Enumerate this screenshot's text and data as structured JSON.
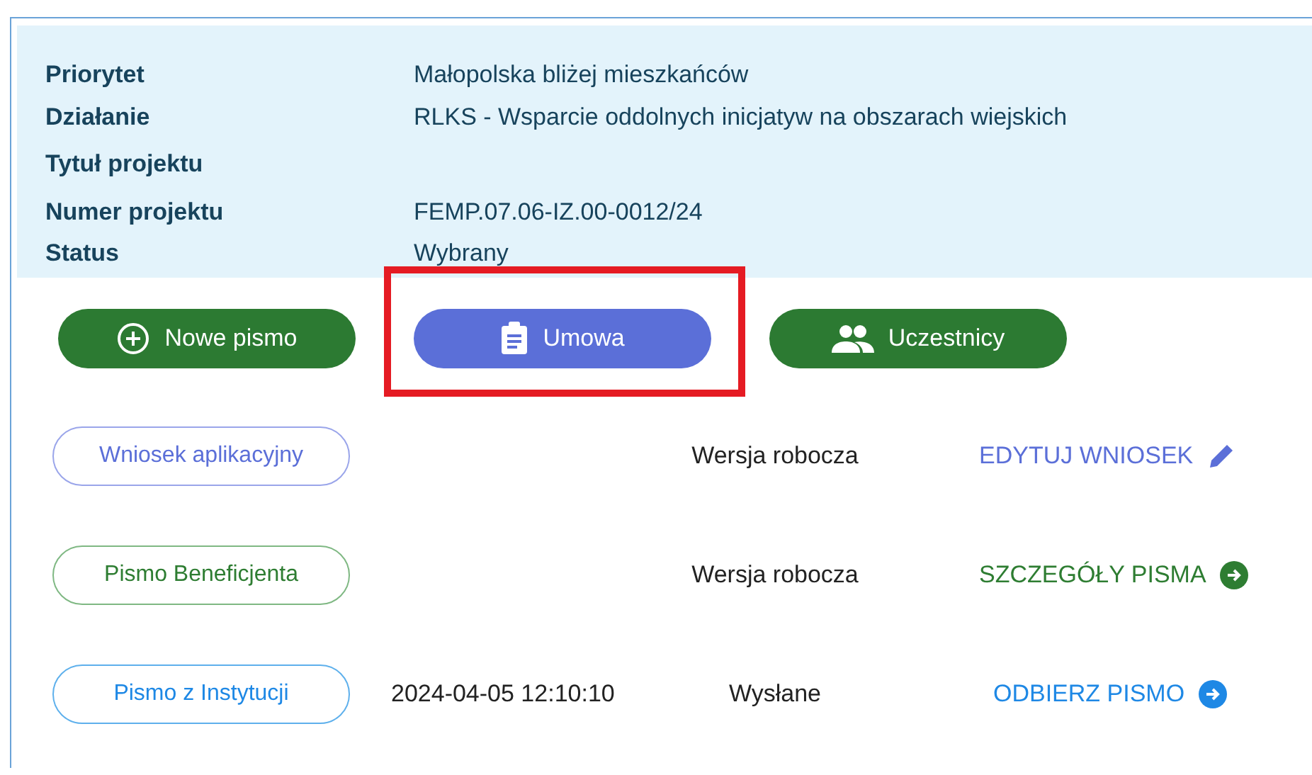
{
  "project_info": [
    {
      "label": "Priorytet",
      "value": "Małopolska bliżej mieszkańców"
    },
    {
      "label": "Działanie",
      "value": "RLKS - Wsparcie oddolnych inicjatyw na obszarach wiejskich"
    },
    {
      "label": "Tytuł projektu"
    },
    {
      "label": "Numer projektu",
      "value": "FEMP.07.06-IZ.00-0012/24"
    },
    {
      "label": "Status",
      "value": "Wybrany"
    }
  ],
  "buttons": [
    {
      "label": "Nowe pismo",
      "kind": "new",
      "highlighted": false
    },
    {
      "label": "Umowa",
      "kind": "contract",
      "highlighted": true
    },
    {
      "label": "Uczestnicy",
      "kind": "participants",
      "highlighted": false
    }
  ],
  "documents": [
    {
      "name": "Wniosek aplikacyjny",
      "kind": "application",
      "status": "Wersja robocza",
      "action": "EDYTUJ WNIOSEK"
    },
    {
      "name": "Pismo Beneficjenta",
      "kind": "beneficiary",
      "status": "Wersja robocza",
      "action": "SZCZEGÓŁY PISMA"
    },
    {
      "name": "Pismo z Instytucji",
      "kind": "institution",
      "date": "2024-04-05 12:10:10",
      "status": "Wysłane",
      "action": "ODBIERZ PISMO"
    }
  ]
}
